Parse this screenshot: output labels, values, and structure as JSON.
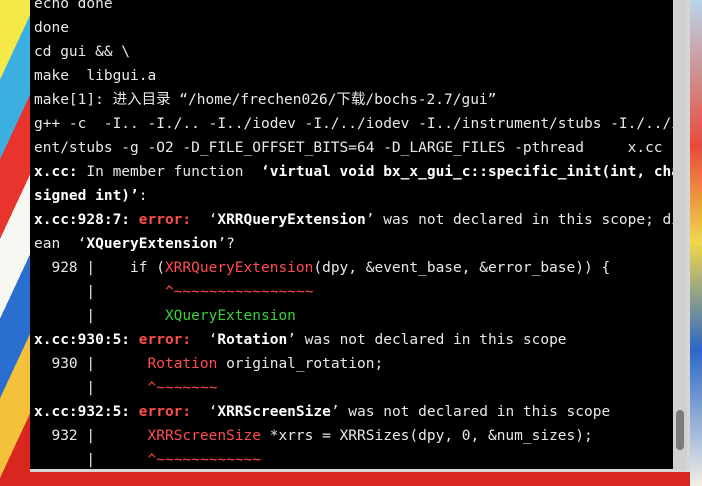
{
  "terminal": {
    "lines": [
      {
        "segments": [
          {
            "text": "echo done",
            "style": ""
          }
        ]
      },
      {
        "segments": [
          {
            "text": "done",
            "style": ""
          }
        ]
      },
      {
        "segments": [
          {
            "text": "cd gui && \\",
            "style": ""
          }
        ]
      },
      {
        "segments": [
          {
            "text": "make  libgui.a",
            "style": ""
          }
        ]
      },
      {
        "segments": [
          {
            "text": "make[1]: 进入目录 “/home/frechen026/下载/bochs-2.7/gui”",
            "style": ""
          }
        ]
      },
      {
        "segments": [
          {
            "text": "g++ -c  -I.. -I./.. -I../iodev -I./../iodev -I../instrument/stubs -I./../instrum",
            "style": ""
          }
        ]
      },
      {
        "segments": [
          {
            "text": "ent/stubs -g -O2 -D_FILE_OFFSET_BITS=64 -D_LARGE_FILES -pthread     x.cc -o x.o",
            "style": ""
          }
        ]
      },
      {
        "segments": [
          {
            "text": "x.cc:",
            "style": "bold white"
          },
          {
            "text": " In member function  ",
            "style": ""
          },
          {
            "text": "‘virtual void bx_x_gui_c::specific_init(int, char**, un",
            "style": "bold white"
          }
        ]
      },
      {
        "segments": [
          {
            "text": "signed int)’",
            "style": "bold white"
          },
          {
            "text": ":",
            "style": ""
          }
        ]
      },
      {
        "segments": [
          {
            "text": "x.cc:928:7: ",
            "style": "bold white"
          },
          {
            "text": "error: ",
            "style": "err"
          },
          {
            "text": " ‘",
            "style": ""
          },
          {
            "text": "XRRQueryExtension",
            "style": "bold white"
          },
          {
            "text": "’ was not declared in this scope; did you m",
            "style": ""
          }
        ]
      },
      {
        "segments": [
          {
            "text": "ean  ‘",
            "style": ""
          },
          {
            "text": "XQueryExtension",
            "style": "bold white"
          },
          {
            "text": "’?",
            "style": ""
          }
        ]
      },
      {
        "segments": [
          {
            "text": "  928 |    if (",
            "style": ""
          },
          {
            "text": "XRRQueryExtension",
            "style": "errtxt"
          },
          {
            "text": "(dpy, &event_base, &error_base)) {",
            "style": ""
          }
        ]
      },
      {
        "segments": [
          {
            "text": "      |        ",
            "style": ""
          },
          {
            "text": "^~~~~~~~~~~~~~~~~",
            "style": "errtxt"
          }
        ]
      },
      {
        "segments": [
          {
            "text": "      |        ",
            "style": ""
          },
          {
            "text": "XQueryExtension",
            "style": "hint"
          }
        ]
      },
      {
        "segments": [
          {
            "text": "x.cc:930:5: ",
            "style": "bold white"
          },
          {
            "text": "error: ",
            "style": "err"
          },
          {
            "text": " ‘",
            "style": ""
          },
          {
            "text": "Rotation",
            "style": "bold white"
          },
          {
            "text": "’ was not declared in this scope",
            "style": ""
          }
        ]
      },
      {
        "segments": [
          {
            "text": "  930 |      ",
            "style": ""
          },
          {
            "text": "Rotation",
            "style": "errtxt"
          },
          {
            "text": " original_rotation;",
            "style": ""
          }
        ]
      },
      {
        "segments": [
          {
            "text": "      |      ",
            "style": ""
          },
          {
            "text": "^~~~~~~~",
            "style": "errtxt"
          }
        ]
      },
      {
        "segments": [
          {
            "text": "x.cc:932:5: ",
            "style": "bold white"
          },
          {
            "text": "error: ",
            "style": "err"
          },
          {
            "text": " ‘",
            "style": ""
          },
          {
            "text": "XRRScreenSize",
            "style": "bold white"
          },
          {
            "text": "’ was not declared in this scope",
            "style": ""
          }
        ]
      },
      {
        "segments": [
          {
            "text": "  932 |      ",
            "style": ""
          },
          {
            "text": "XRRScreenSize",
            "style": "errtxt"
          },
          {
            "text": " *xrrs = XRRSizes(dpy, 0, &num_sizes);",
            "style": ""
          }
        ]
      },
      {
        "segments": [
          {
            "text": "      |      ",
            "style": ""
          },
          {
            "text": "^~~~~~~~~~~~~",
            "style": "errtxt"
          }
        ]
      }
    ]
  },
  "colors": {
    "terminal_bg": "#000000",
    "text": "#e8e8e8",
    "error": "#ff4d4d",
    "hint": "#3ccf3c",
    "scrollbar": "#cfcfcf"
  }
}
